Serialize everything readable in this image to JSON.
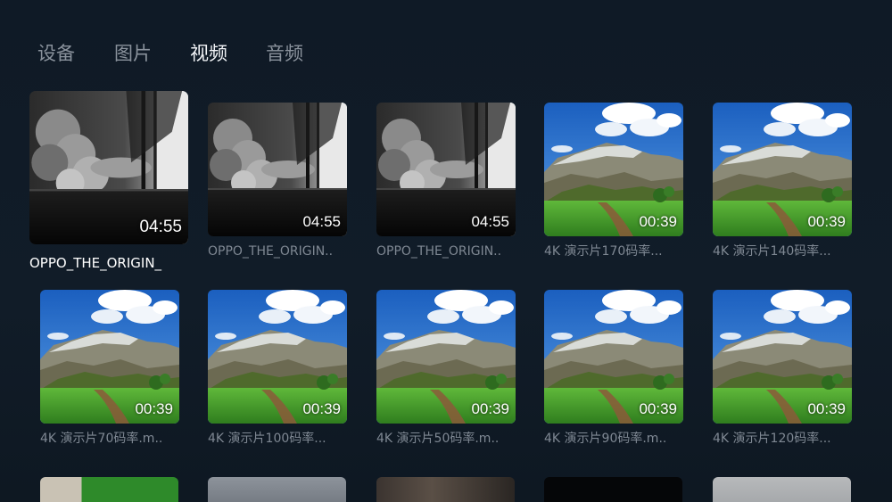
{
  "tabs": [
    {
      "label": "设备",
      "active": false
    },
    {
      "label": "图片",
      "active": false
    },
    {
      "label": "视频",
      "active": true
    },
    {
      "label": "音频",
      "active": false
    }
  ],
  "videos": [
    {
      "title": "OPPO_THE_ORIGIN_",
      "duration": "04:55",
      "thumbnail": "smoke-monochrome",
      "focused": true
    },
    {
      "title": "OPPO_THE_ORIGIN..",
      "duration": "04:55",
      "thumbnail": "smoke-monochrome"
    },
    {
      "title": "OPPO_THE_ORIGIN..",
      "duration": "04:55",
      "thumbnail": "smoke-monochrome"
    },
    {
      "title": "4K 演示片170码率...",
      "duration": "00:39",
      "thumbnail": "mountain-landscape"
    },
    {
      "title": "4K 演示片140码率...",
      "duration": "00:39",
      "thumbnail": "mountain-landscape"
    },
    {
      "title": "4K 演示片70码率.m..",
      "duration": "00:39",
      "thumbnail": "mountain-landscape"
    },
    {
      "title": "4K 演示片100码率...",
      "duration": "00:39",
      "thumbnail": "mountain-landscape"
    },
    {
      "title": "4K 演示片50码率.m..",
      "duration": "00:39",
      "thumbnail": "mountain-landscape"
    },
    {
      "title": "4K 演示片90码率.m..",
      "duration": "00:39",
      "thumbnail": "mountain-landscape"
    },
    {
      "title": "4K 演示片120码率...",
      "duration": "00:39",
      "thumbnail": "mountain-landscape"
    }
  ],
  "partial_row_thumbnails": [
    "green-screen",
    "grey-sky",
    "dark-interior",
    "black",
    "light-grey"
  ]
}
